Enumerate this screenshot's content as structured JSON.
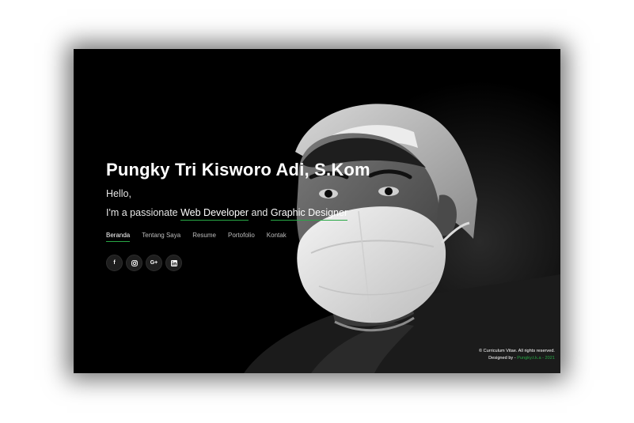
{
  "hero": {
    "title": "Pungky Tri Kisworo Adi, S.Kom",
    "greeting": "Hello,",
    "tagline_prefix": "I'm a passionate ",
    "role_1": "Web Developer",
    "tagline_join": " and ",
    "role_2": "Graphic Designer"
  },
  "nav": {
    "items": [
      {
        "label": "Beranda",
        "active": true
      },
      {
        "label": "Tentang Saya"
      },
      {
        "label": "Resume"
      },
      {
        "label": "Portofolio"
      },
      {
        "label": "Kontak"
      }
    ]
  },
  "social": {
    "facebook_glyph": "f",
    "googleplus_glyph": "G+",
    "icons": [
      "facebook-icon",
      "instagram-icon",
      "google-plus-icon",
      "linkedin-icon"
    ]
  },
  "footer": {
    "copyright": "© Curriculum Vitae. All rights reserved.",
    "designed_by": "Designed by - ",
    "brand": "Pungky.t.k.a - 2021"
  },
  "colors": {
    "accent": "#28a745",
    "background": "#000000",
    "text": "#ffffff"
  }
}
